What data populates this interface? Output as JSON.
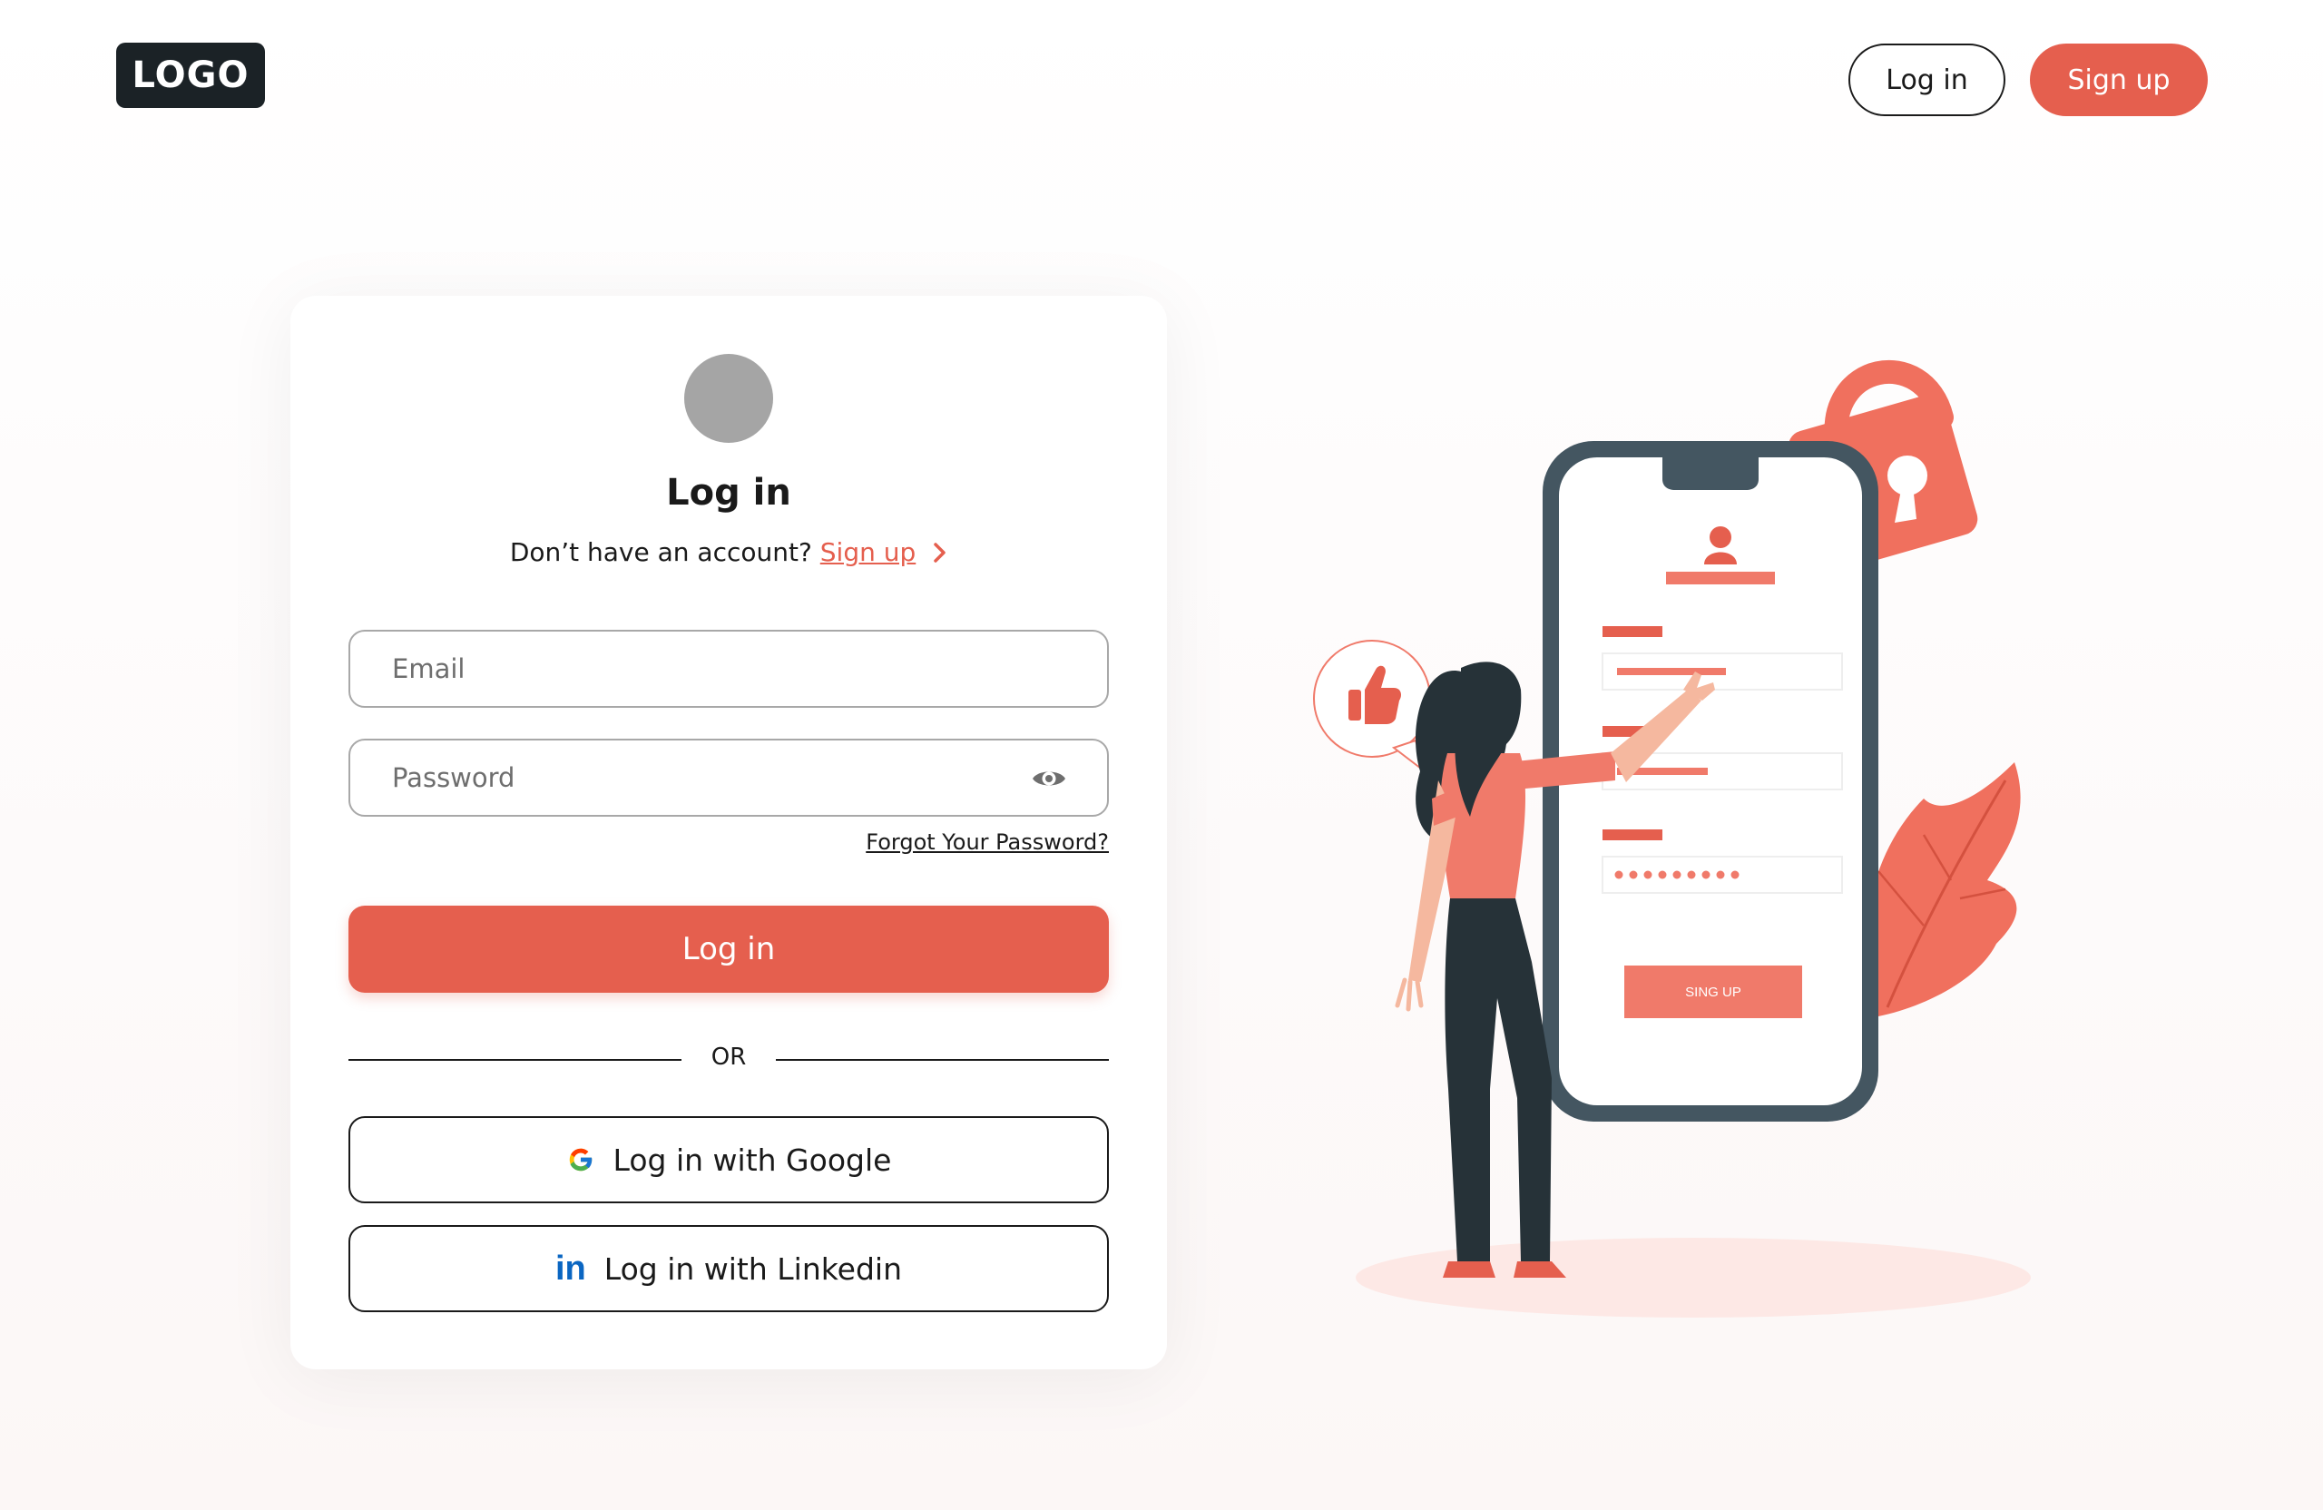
{
  "header": {
    "logo_text": "LOGO",
    "login_label": "Log in",
    "signup_label": "Sign up"
  },
  "card": {
    "title": "Log in",
    "no_account_text": "Don’t have an account?",
    "signup_link": "Sign up",
    "email_placeholder": "Email",
    "password_placeholder": "Password",
    "forgot_label": "Forgot Your Password?",
    "login_button": "Log in",
    "or_text": "OR",
    "google_button": "Log in with Google",
    "linkedin_button": "Log in with Linkedin",
    "linkedin_icon_text": "in"
  },
  "illustration": {
    "phone_button_text": "SING UP"
  },
  "colors": {
    "accent": "#e55f4e",
    "dark": "#1b2226",
    "phone_frame": "#445661",
    "avatar_placeholder": "#a5a5a5"
  }
}
